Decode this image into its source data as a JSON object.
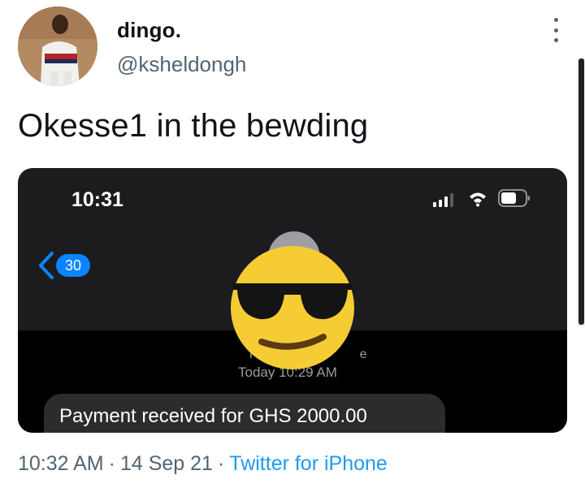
{
  "tweet": {
    "user": {
      "display_name": "dingo.",
      "handle": "@ksheldongh"
    },
    "text": "Okesse1 in the bewding",
    "timestamp": "10:32 AM",
    "date": "14 Sep 21",
    "separator": "·",
    "source": "Twitter for iPhone",
    "more_icon": "more-vertical-icon"
  },
  "screenshot": {
    "status_bar": {
      "time": "10:31",
      "icons": [
        "signal-icon",
        "wifi-icon",
        "battery-icon"
      ]
    },
    "back_badge": "30",
    "sender_partial": "Tge",
    "message_time": "Today 10:29 AM",
    "message": "Payment received for GHS 2000.00",
    "overlay": "sunglasses-emoji"
  },
  "colors": {
    "accent": "#1d9bf0",
    "secondary_text": "#536471",
    "ios_blue": "#0a84ff",
    "emoji_yellow": "#f5cc33"
  }
}
